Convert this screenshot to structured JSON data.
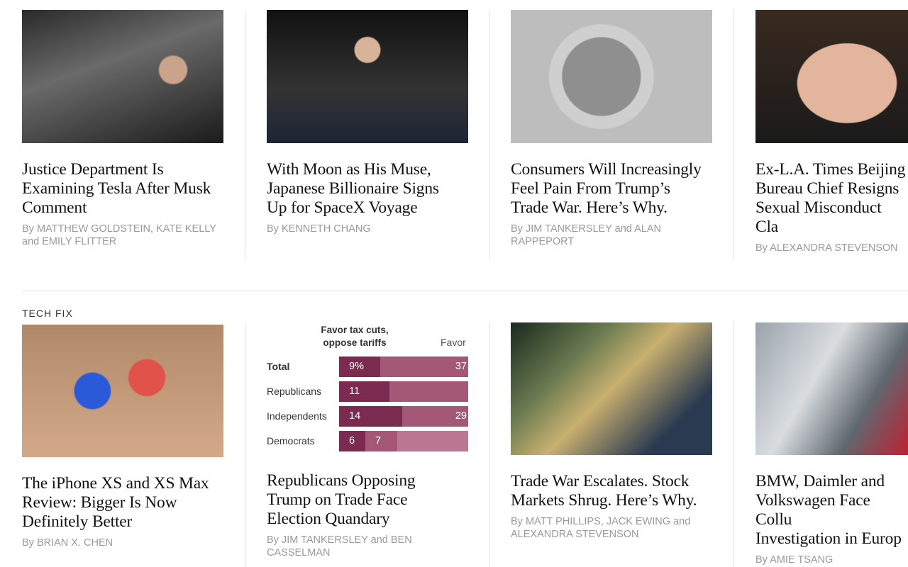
{
  "section_label": "TECH FIX",
  "colors": {
    "headline": "#121212",
    "byline": "#999999",
    "chart_dark": "#7b2a50",
    "chart_mid": "#a45876",
    "chart_light": "#b97790"
  },
  "row1": [
    {
      "headline": "Justice Department Is\nExamining Tesla After Musk\nComment",
      "byline": "By MATTHEW GOLDSTEIN, KATE KELLY\nand EMILY FLITTER",
      "image": "photo-elon-musk"
    },
    {
      "headline": "With Moon as His Muse,\nJapanese Billionaire Signs\nUp for SpaceX Voyage",
      "byline": "By KENNETH CHANG",
      "image": "photo-yusaku-maezawa"
    },
    {
      "headline": "Consumers Will Increasingly\nFeel Pain From Trump’s\nTrade War. Here’s Why.",
      "byline": "By JIM TANKERSLEY and ALAN\nRAPPEPORT",
      "image": "photo-factory-worker"
    },
    {
      "headline": "Ex-L.A. Times Beijing\nBureau Chief Resigns\nSexual Misconduct Cla",
      "byline": "By ALEXANDRA STEVENSON",
      "image": "photo-portrait-man"
    }
  ],
  "row2": [
    {
      "headline": "The iPhone XS and XS Max\nReview: Bigger Is Now\nDefinitely Better",
      "byline": "By BRIAN X. CHEN",
      "image": "photo-iphones"
    },
    {
      "headline": "Republicans Opposing\nTrump on Trade Face\nElection Quandary",
      "byline": "By JIM TANKERSLEY and BEN\nCASSELMAN",
      "image": "chart-thumbnail"
    },
    {
      "headline": "Trade War Escalates. Stock\nMarkets Shrug. Here’s Why.",
      "byline": "By MATT PHILLIPS, JACK EWING and\nALEXANDRA STEVENSON",
      "image": "photo-stock-board"
    },
    {
      "headline": "BMW, Daimler and\nVolkswagen Face Collu\nInvestigation in Europ",
      "byline": "By AMIE TSANG",
      "image": "photo-car-tower"
    }
  ],
  "chart_thumbnail": {
    "title": "Favor tax cuts,\noppose tariffs",
    "right_header": "Favor",
    "rows": [
      {
        "label": "Total",
        "values": [
          "9%",
          "37"
        ]
      },
      {
        "label": "Republicans",
        "values": [
          "11",
          ""
        ]
      },
      {
        "label": "Independents",
        "values": [
          "14",
          "29"
        ]
      },
      {
        "label": "Democrats",
        "values": [
          "6",
          "7",
          ""
        ]
      }
    ]
  }
}
